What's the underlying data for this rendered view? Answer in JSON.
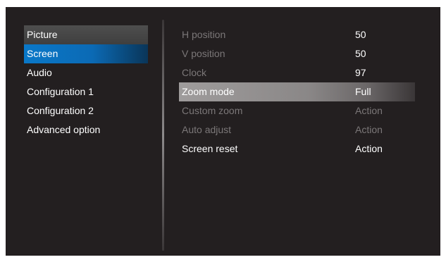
{
  "sidebar": {
    "items": [
      {
        "label": "Picture"
      },
      {
        "label": "Screen"
      },
      {
        "label": "Audio"
      },
      {
        "label": "Configuration 1"
      },
      {
        "label": "Configuration 2"
      },
      {
        "label": "Advanced option"
      }
    ]
  },
  "screen_settings": {
    "rows": [
      {
        "label": "H position",
        "value": "50"
      },
      {
        "label": "V position",
        "value": "50"
      },
      {
        "label": "Clock",
        "value": "97"
      },
      {
        "label": "Zoom mode",
        "value": "Full"
      },
      {
        "label": "Custom zoom",
        "value": "Action"
      },
      {
        "label": "Auto adjust",
        "value": "Action"
      },
      {
        "label": "Screen reset",
        "value": "Action"
      }
    ]
  },
  "colors": {
    "osd_background": "#231f20",
    "selected_tab": "#0a78c8",
    "focused_row": "#9f9c9c",
    "disabled_text": "#7b7778",
    "text": "#ffffff"
  }
}
